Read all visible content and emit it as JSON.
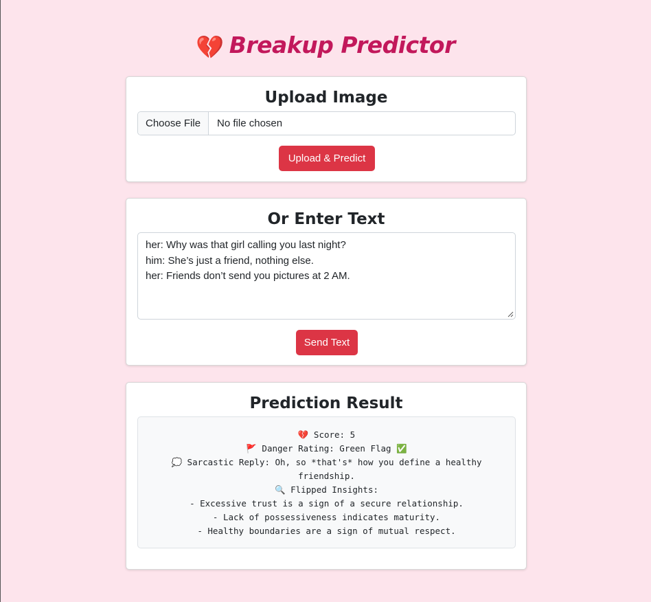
{
  "header": {
    "heart_icon": "💔",
    "title": "Breakup Predictor"
  },
  "upload": {
    "heading": "Upload Image",
    "choose_file_label": "Choose File",
    "file_status": "No file chosen",
    "button_label": "Upload & Predict"
  },
  "text_entry": {
    "heading": "Or Enter Text",
    "lines": [
      "her: Why was that girl calling you last night?",
      "him: She’s just a friend, nothing else.",
      "her: Friends don’t send you pictures at 2 AM."
    ],
    "button_label": "Send Text"
  },
  "result": {
    "heading": "Prediction Result",
    "lines": [
      "💔 Score: 5",
      "🚩 Danger Rating: Green Flag ✅",
      "💭 Sarcastic Reply: Oh, so *that's* how you define a healthy friendship.",
      "🔍 Flipped Insights:",
      "- Excessive trust is a sign of a secure relationship.",
      "- Lack of possessiveness indicates maturity.",
      "- Healthy boundaries are a sign of mutual respect."
    ]
  },
  "colors": {
    "background": "#fde4ec",
    "title": "#c2185b",
    "button": "#dc3545"
  }
}
